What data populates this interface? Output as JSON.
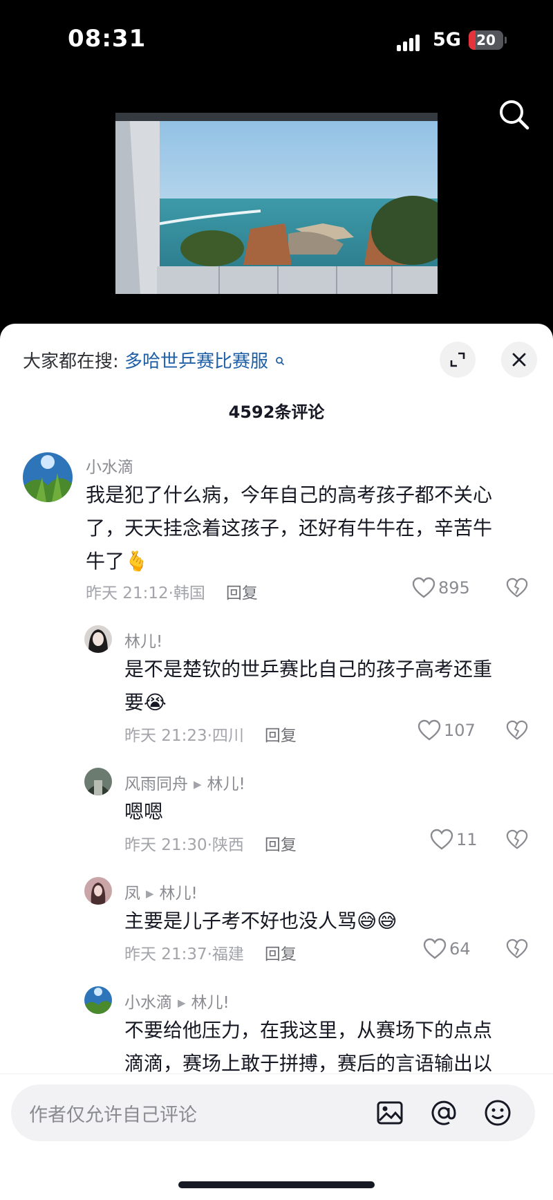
{
  "status_bar": {
    "time": "08:31",
    "network": "5G",
    "battery": "20",
    "battery_fraction": 0.2
  },
  "header": {
    "search_icon": "search-icon"
  },
  "sheet": {
    "trend_prefix": "大家都在搜:",
    "trend_keyword": "多哈世乒赛比赛服",
    "comment_count": "4592条评论"
  },
  "comments": [
    {
      "user": "小水滴",
      "text_lines": [
        "我是犯了什么病，今年自己的高考孩子都不关心",
        "了，天天挂念着这孩子，还好有牛牛在，辛苦牛",
        "牛了"
      ],
      "emoji": "🫰",
      "time": "昨天 21:12",
      "location": "韩国",
      "reply": "回复",
      "likes": "895"
    },
    {
      "user": "林儿!",
      "text_lines": [
        "是不是楚钦的世乒赛比自己的孩子高考还重",
        "要"
      ],
      "emoji": "😭",
      "time": "昨天 21:23",
      "location": "四川",
      "reply": "回复",
      "likes": "107"
    },
    {
      "user": "风雨同舟",
      "reply_to": "林儿!",
      "text_lines": [
        "嗯嗯"
      ],
      "time": "昨天 21:30",
      "location": "陕西",
      "reply": "回复",
      "likes": "11"
    },
    {
      "user": "凤",
      "reply_to": "林儿!",
      "text_lines": [
        "主要是儿子考不好也没人骂"
      ],
      "emoji": "😅😅",
      "time": "昨天 21:37",
      "location": "福建",
      "reply": "回复",
      "likes": "64"
    },
    {
      "user": "小水滴",
      "reply_to": "林儿!",
      "text_lines": [
        "不要给他压力，在我这里，从赛场下的点点",
        "滴滴，赛场上敢于拼搏，赛后的言语输出以"
      ]
    }
  ],
  "input_bar": {
    "placeholder": "作者仅允许自己评论"
  },
  "colors": {
    "keyword": "#1f5fa6",
    "battery_red": "#e5333c"
  }
}
